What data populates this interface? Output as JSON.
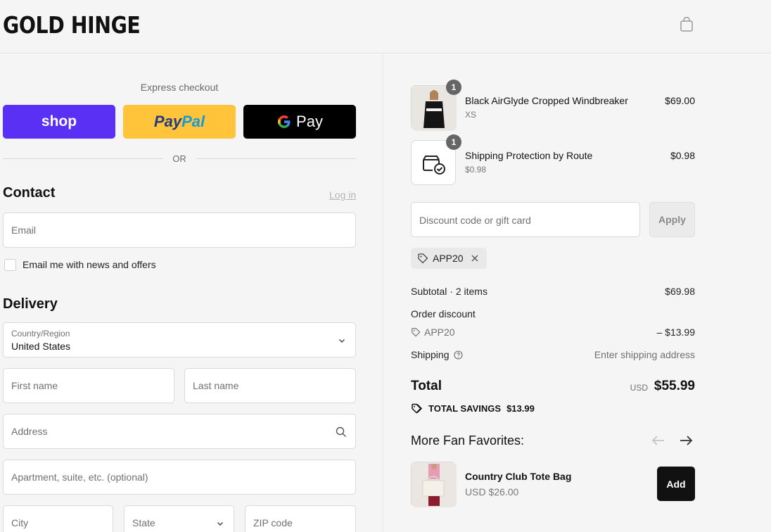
{
  "header": {
    "logo": "GOLD HINGE",
    "cart_icon": "shopping-bag-icon"
  },
  "express": {
    "title": "Express checkout",
    "shop_label": "shop",
    "paypal_part1": "Pay",
    "paypal_part2": "Pal",
    "gpay_label": "Pay",
    "or_label": "OR"
  },
  "contact": {
    "heading": "Contact",
    "login_link": "Log in",
    "email_placeholder": "Email",
    "newsletter_label": "Email me with news and offers"
  },
  "delivery": {
    "heading": "Delivery",
    "country_label": "Country/Region",
    "country_value": "United States",
    "first_name_placeholder": "First name",
    "last_name_placeholder": "Last name",
    "address_placeholder": "Address",
    "apartment_placeholder": "Apartment, suite, etc. (optional)",
    "city_placeholder": "City",
    "state_placeholder": "State",
    "zip_placeholder": "ZIP code"
  },
  "cart": {
    "items": [
      {
        "name": "Black AirGlyde Cropped Windbreaker",
        "variant": "XS",
        "price": "$69.00",
        "qty": "1"
      },
      {
        "name": "Shipping Protection by Route",
        "variant": "$0.98",
        "price": "$0.98",
        "qty": "1"
      }
    ],
    "discount_placeholder": "Discount code or gift card",
    "apply_label": "Apply",
    "applied_code": "APP20"
  },
  "summary": {
    "subtotal_label": "Subtotal · 2 items",
    "subtotal_value": "$69.98",
    "order_discount_label": "Order discount",
    "discount_code": "APP20",
    "discount_value": "– $13.99",
    "shipping_label": "Shipping",
    "shipping_value": "Enter shipping address",
    "total_label": "Total",
    "currency": "USD",
    "total_value": "$55.99",
    "savings_label": "TOTAL SAVINGS",
    "savings_value": "$13.99"
  },
  "favorites": {
    "title": "More Fan Favorites:",
    "product_name": "Country Club Tote Bag",
    "product_price": "USD $26.00",
    "add_label": "Add"
  },
  "colors": {
    "shop": "#5a31f4",
    "paypal": "#ffc439",
    "gpay": "#000000",
    "accent": "#111111"
  }
}
